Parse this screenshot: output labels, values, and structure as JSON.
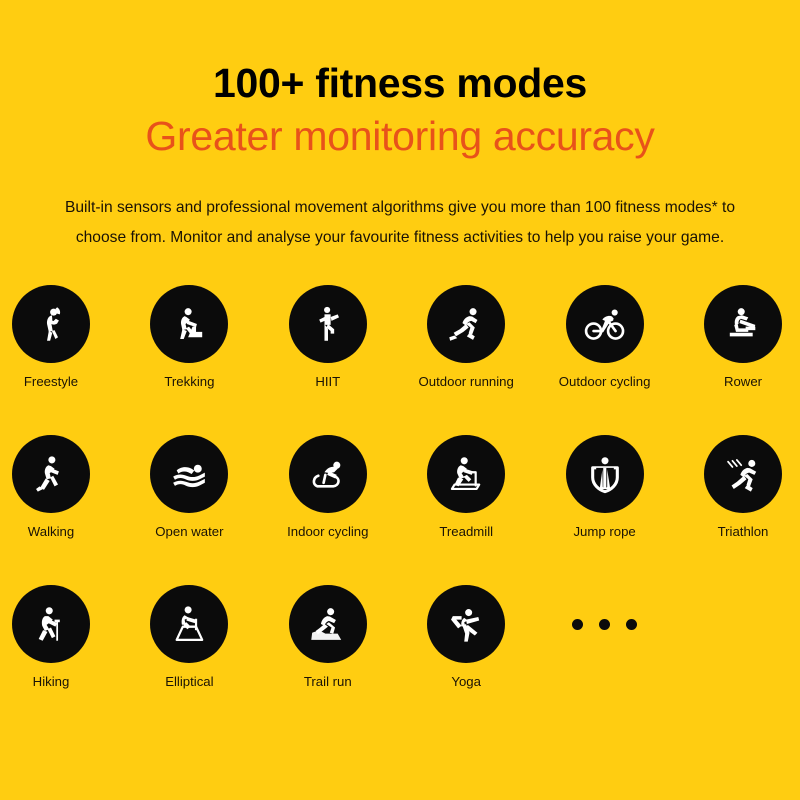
{
  "page": {
    "background_color": "#FFCD11",
    "circle_color": "#0B0B0B",
    "icon_color": "#FFFFFF",
    "accent_color": "#E8521A",
    "text_color": "#1B1305"
  },
  "heading": {
    "line1": "100+ fitness modes",
    "line2": "Greater monitoring accuracy"
  },
  "body": {
    "line1": "Built-in sensors and professional movement algorithms give you more than 100 fitness modes* to",
    "line2": "choose from. Monitor and analyse your favourite fitness activities to help you raise your game."
  },
  "grid": {
    "rows": [
      {
        "items": [
          {
            "label": "Freestyle",
            "icon": "freestyle-icon"
          },
          {
            "label": "Trekking",
            "icon": "trekking-icon"
          },
          {
            "label": "HIIT",
            "icon": "hiit-icon"
          },
          {
            "label": "Outdoor running",
            "icon": "outdoor-running-icon"
          },
          {
            "label": "Outdoor cycling",
            "icon": "outdoor-cycling-icon"
          },
          {
            "label": "Rower",
            "icon": "rower-icon"
          }
        ]
      },
      {
        "items": [
          {
            "label": "Walking",
            "icon": "walking-icon"
          },
          {
            "label": "Open water",
            "icon": "open-water-icon"
          },
          {
            "label": "Indoor cycling",
            "icon": "indoor-cycling-icon"
          },
          {
            "label": "Treadmill",
            "icon": "treadmill-icon"
          },
          {
            "label": "Jump rope",
            "icon": "jump-rope-icon"
          },
          {
            "label": "Triathlon",
            "icon": "triathlon-icon"
          }
        ]
      },
      {
        "items": [
          {
            "label": "Hiking",
            "icon": "hiking-icon"
          },
          {
            "label": "Elliptical",
            "icon": "elliptical-icon"
          },
          {
            "label": "Trail run",
            "icon": "trail-run-icon"
          },
          {
            "label": "Yoga",
            "icon": "yoga-icon"
          }
        ],
        "ellipsis": {
          "dots": 3
        }
      }
    ]
  }
}
